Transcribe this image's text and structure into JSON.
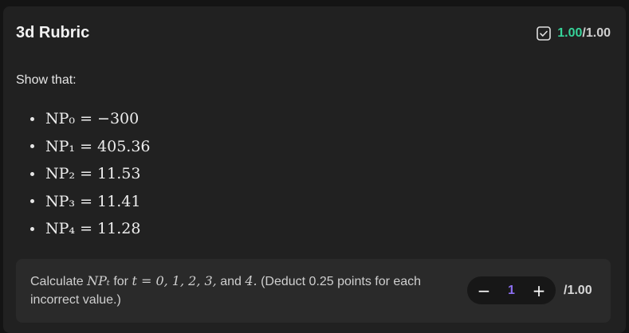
{
  "card": {
    "title": "3d Rubric",
    "score": {
      "earned": "1.00",
      "total": "/1.00"
    }
  },
  "content": {
    "intro": "Show that:",
    "items": [
      "NP₀ = −300",
      "NP₁ = 405.36",
      "NP₂ = 11.53",
      "NP₃ = 11.41",
      "NP₄ = 11.28"
    ]
  },
  "criterion": {
    "prefix": "Calculate ",
    "math1": "NPₜ",
    "middle": " for ",
    "math2": "t = 0, 1, 2, 3,",
    "middle2": " and ",
    "math3": "4.",
    "suffix": " (Deduct 0.25 points for each incorrect value.)"
  },
  "grading": {
    "minus_label": "−",
    "value": "1",
    "plus_label": "+",
    "max": "/1.00"
  },
  "colors": {
    "earned": "#36d399",
    "stepper_value": "#8b6ef0"
  },
  "icons": {
    "score_status": "checkbox-checked-icon"
  }
}
